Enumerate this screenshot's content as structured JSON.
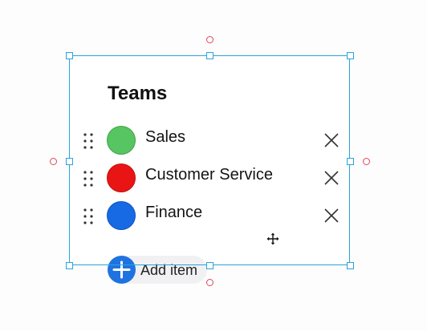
{
  "card": {
    "title": "Teams"
  },
  "items": [
    {
      "label": "Sales",
      "color": "#57c561",
      "border": "#3ea448"
    },
    {
      "label": "Customer Service",
      "color": "#e91515",
      "border": "#c40f0f"
    },
    {
      "label": "Finance",
      "color": "#1769e4",
      "border": "#0f55c0"
    }
  ],
  "add_button": {
    "label": "Add item",
    "color": "#1f73e0"
  },
  "selection": {
    "accent": "#2aa3dc",
    "rotate_handle_color": "#e0475a"
  },
  "icons": {
    "drag": "drag-handle-icon",
    "remove": "close-icon",
    "add": "plus-icon",
    "cursor": "move-cursor-icon"
  }
}
